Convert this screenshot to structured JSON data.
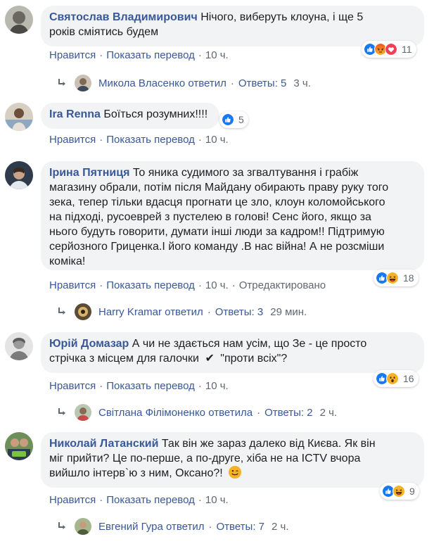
{
  "actions": {
    "like": "Нравится",
    "translate": "Показать перевод",
    "edited": "Отредактировано",
    "separator": "·"
  },
  "comments": [
    {
      "author": "Святослав Владимирович",
      "text_lines": [
        "Нічого, виберуть клоуна, і ще 5",
        "років сміятись будем"
      ],
      "time": "10 ч.",
      "reactions": {
        "icons": [
          "like-icon",
          "angry-icon",
          "love-icon"
        ],
        "count": "11"
      },
      "reply": {
        "name": "Микола Власенко ответил",
        "replies": "Ответы: 5",
        "time": "3 ч."
      }
    },
    {
      "author": "Ira Renna",
      "text_lines": [
        "Боїться розумних!!!!"
      ],
      "time": "10 ч.",
      "reactions": {
        "icons": [
          "like-icon"
        ],
        "count": "5"
      }
    },
    {
      "author": "Ірина Пятниця",
      "text_lines": [
        "То яника судимого за згвалтування і грабіж",
        "магазину обрали, потім після Майдану обирають праву руку того",
        "зека, тепер тільки вдасця прогнати це зло, клоун коломойського",
        "на підході, русоеврей з пустелею в голові! Сенс його, якщо за",
        "нього будуть говорити, думати інші люди за кадром!! Підтримую",
        "серйозного Гриценка.І його команду .В нас війна! А не розсміши",
        "коміка!"
      ],
      "time": "10 ч.",
      "edited": true,
      "reactions": {
        "icons": [
          "like-icon",
          "haha-icon"
        ],
        "count": "18"
      },
      "reply": {
        "name": "Harry Kramar ответил",
        "replies": "Ответы: 3",
        "time": "29 мин."
      }
    },
    {
      "author": "Юрій Домазар",
      "text_lines": [
        "А чи не здається нам усім, що Зе - це просто",
        "стрічка з місцем для галочки",
        "\"проти всіх\"?"
      ],
      "checkmark": "✔",
      "time": "10 ч.",
      "reactions": {
        "icons": [
          "like-icon",
          "wow-icon"
        ],
        "count": "16"
      },
      "reply": {
        "name": "Світлана Філімоненко ответила",
        "replies": "Ответы: 2",
        "time": "2 ч."
      }
    },
    {
      "author": "Николай Латанский",
      "text_lines": [
        "Так він же зараз далеко від Києва. Як він",
        "міг прийти? Це по-перше, а по-друге, хіба не на ICTV вчора",
        "вийшло інтерв`ю з ним, Оксано?!"
      ],
      "emoji": "wink-emoji",
      "time": "10 ч.",
      "reactions": {
        "icons": [
          "like-icon",
          "haha-icon"
        ],
        "count": "9"
      },
      "reply": {
        "name": "Евгений Гура ответил",
        "replies": "Ответы: 7",
        "time": "2 ч."
      }
    }
  ],
  "colors": {
    "link": "#385898",
    "meta": "#606770",
    "bubble": "#f2f3f5",
    "like": "#1877f2",
    "love": "#f33e58",
    "emoji": "#f7b125"
  }
}
